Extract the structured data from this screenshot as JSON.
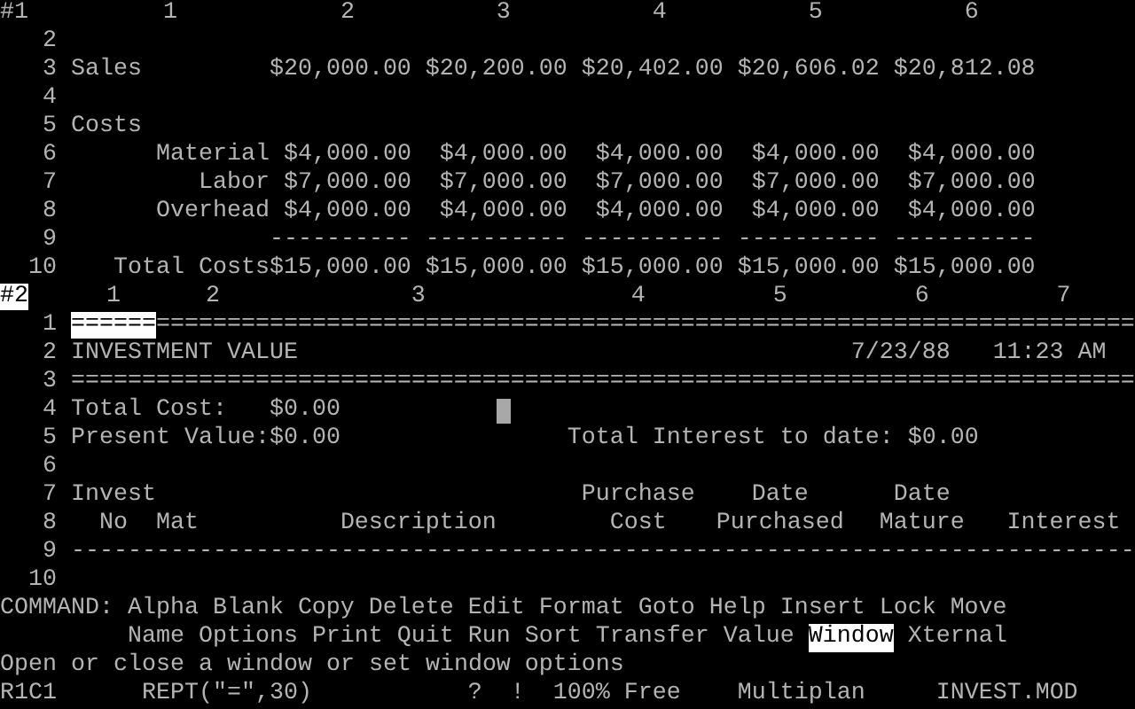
{
  "windows": [
    {
      "label": "#1",
      "active": false,
      "columns": [
        "1",
        "2",
        "3",
        "4",
        "5",
        "6"
      ],
      "rows": [
        {
          "number": "2",
          "text_cursor": false,
          "cells": []
        },
        {
          "number": "3",
          "text_cursor": false,
          "cells": [
            {
              "kind": "label",
              "text": "Sales",
              "selected": false
            },
            {
              "kind": "number",
              "text": "$20,000.00",
              "selected": false
            },
            {
              "kind": "number",
              "text": "$20,200.00",
              "selected": false
            },
            {
              "kind": "number",
              "text": "$20,402.00",
              "selected": false
            },
            {
              "kind": "number",
              "text": "$20,606.02",
              "selected": false
            },
            {
              "kind": "number",
              "text": "$20,812.08",
              "selected": false
            }
          ]
        },
        {
          "number": "4",
          "text_cursor": false,
          "cells": []
        },
        {
          "number": "5",
          "text_cursor": false,
          "cells": [
            {
              "kind": "label",
              "text": "Costs",
              "selected": false
            }
          ]
        },
        {
          "number": "6",
          "text_cursor": false,
          "cells": [
            {
              "kind": "item",
              "text": "Material",
              "selected": false
            },
            {
              "kind": "number",
              "text": "$4,000.00",
              "selected": false
            },
            {
              "kind": "number",
              "text": "$4,000.00",
              "selected": false
            },
            {
              "kind": "number",
              "text": "$4,000.00",
              "selected": false
            },
            {
              "kind": "number",
              "text": "$4,000.00",
              "selected": false
            },
            {
              "kind": "number",
              "text": "$4,000.00",
              "selected": false
            }
          ]
        },
        {
          "number": "7",
          "text_cursor": false,
          "cells": [
            {
              "kind": "item",
              "text": "Labor",
              "selected": false
            },
            {
              "kind": "number",
              "text": "$7,000.00",
              "selected": false
            },
            {
              "kind": "number",
              "text": "$7,000.00",
              "selected": false
            },
            {
              "kind": "number",
              "text": "$7,000.00",
              "selected": false
            },
            {
              "kind": "number",
              "text": "$7,000.00",
              "selected": false
            },
            {
              "kind": "number",
              "text": "$7,000.00",
              "selected": false
            }
          ]
        },
        {
          "number": "8",
          "text_cursor": false,
          "cells": [
            {
              "kind": "item",
              "text": "Overhead",
              "selected": false
            },
            {
              "kind": "number",
              "text": "$4,000.00",
              "selected": false
            },
            {
              "kind": "number",
              "text": "$4,000.00",
              "selected": false
            },
            {
              "kind": "number",
              "text": "$4,000.00",
              "selected": false
            },
            {
              "kind": "number",
              "text": "$4,000.00",
              "selected": false
            },
            {
              "kind": "number",
              "text": "$4,000.00",
              "selected": false
            }
          ]
        },
        {
          "number": "9",
          "text_cursor": false,
          "cells": [
            "",
            {
              "kind": "number",
              "text": "----------",
              "selected": false
            },
            {
              "kind": "number",
              "text": "----------",
              "selected": false
            },
            {
              "kind": "number",
              "text": "----------",
              "selected": false
            },
            {
              "kind": "number",
              "text": "----------",
              "selected": false
            },
            {
              "kind": "number",
              "text": "----------",
              "selected": false
            }
          ]
        },
        {
          "number": "10",
          "text_cursor": false,
          "cells": [
            {
              "kind": "item",
              "text": "Total Costs",
              "selected": false
            },
            {
              "kind": "number",
              "text": "$15,000.00",
              "selected": false
            },
            {
              "kind": "number",
              "text": "$15,000.00",
              "selected": false
            },
            {
              "kind": "number",
              "text": "$15,000.00",
              "selected": false
            },
            {
              "kind": "number",
              "text": "$15,000.00",
              "selected": false
            },
            {
              "kind": "number",
              "text": "$15,000.00",
              "selected": false
            }
          ]
        }
      ]
    },
    {
      "label": "#2",
      "active": true,
      "columns": [
        "1",
        "2",
        "3",
        "4",
        "5",
        "6",
        "7"
      ],
      "rows": [
        {
          "number": "1",
          "text_cursor": false,
          "cells": [
            {
              "kind": "label",
              "text": "======",
              "selected": true
            },
            {
              "kind": "label",
              "text": "=====================================================================",
              "selected": false
            }
          ]
        },
        {
          "number": "2",
          "text_cursor": false,
          "cells": [
            {
              "kind": "label",
              "text": "INVESTMENT VALUE",
              "selected": false
            },
            "",
            "",
            "",
            "",
            {
              "kind": "label",
              "text": "7/23/88",
              "selected": false
            },
            {
              "kind": "label",
              "text": "11:23 AM",
              "selected": false
            }
          ]
        },
        {
          "number": "3",
          "text_cursor": false,
          "cells": [
            {
              "kind": "label",
              "text": "===========================================================================",
              "selected": false
            }
          ]
        },
        {
          "number": "4",
          "text_cursor": true,
          "cells": [
            {
              "kind": "label",
              "text": "Total Cost:",
              "selected": false
            },
            "",
            {
              "kind": "label",
              "text": "$0.00",
              "selected": false
            }
          ]
        },
        {
          "number": "5",
          "text_cursor": false,
          "cells": [
            {
              "kind": "label",
              "text": "Present Value:",
              "selected": false
            },
            "",
            {
              "kind": "label",
              "text": "$0.00",
              "selected": false
            },
            {
              "kind": "label",
              "text": "Total Interest to date: $0.00",
              "selected": false
            }
          ]
        },
        {
          "number": "6",
          "text_cursor": false,
          "cells": []
        },
        {
          "number": "7",
          "text_cursor": false,
          "cells": [
            {
              "kind": "label",
              "text": "Invest",
              "selected": false
            },
            "",
            "",
            {
              "kind": "heading",
              "text": "Purchase",
              "selected": false
            },
            {
              "kind": "heading",
              "text": "Date",
              "selected": false
            },
            {
              "kind": "heading",
              "text": "Date",
              "selected": false
            }
          ]
        },
        {
          "number": "8",
          "text_cursor": false,
          "cells": [
            {
              "kind": "heading",
              "text": "No",
              "selected": false
            },
            {
              "kind": "label",
              "text": "Mat",
              "selected": false
            },
            {
              "kind": "heading",
              "text": "Description",
              "selected": false
            },
            {
              "kind": "heading",
              "text": "Cost",
              "selected": false
            },
            {
              "kind": "heading",
              "text": "Purchased",
              "selected": false
            },
            {
              "kind": "heading",
              "text": "Mature",
              "selected": false
            },
            {
              "kind": "heading",
              "text": "Interest",
              "selected": false
            }
          ]
        },
        {
          "number": "9",
          "text_cursor": false,
          "cells": [
            {
              "kind": "label",
              "text": "---------------------------------------------------------------------------",
              "selected": false
            }
          ]
        },
        {
          "number": "10",
          "text_cursor": false,
          "cells": []
        }
      ]
    }
  ],
  "command": {
    "label": "COMMAND:",
    "lines": [
      [
        {
          "label": "Alpha",
          "selected": false
        },
        {
          "label": "Blank",
          "selected": false
        },
        {
          "label": "Copy",
          "selected": false
        },
        {
          "label": "Delete",
          "selected": false
        },
        {
          "label": "Edit",
          "selected": false
        },
        {
          "label": "Format",
          "selected": false
        },
        {
          "label": "Goto",
          "selected": false
        },
        {
          "label": "Help",
          "selected": false
        },
        {
          "label": "Insert",
          "selected": false
        },
        {
          "label": "Lock",
          "selected": false
        },
        {
          "label": "Move",
          "selected": false
        }
      ],
      [
        {
          "label": "Name",
          "selected": false
        },
        {
          "label": "Options",
          "selected": false
        },
        {
          "label": "Print",
          "selected": false
        },
        {
          "label": "Quit",
          "selected": false
        },
        {
          "label": "Run",
          "selected": false
        },
        {
          "label": "Sort",
          "selected": false
        },
        {
          "label": "Transfer",
          "selected": false
        },
        {
          "label": "Value",
          "selected": false
        },
        {
          "label": "Window",
          "selected": true
        },
        {
          "label": "Xternal",
          "selected": false
        }
      ]
    ]
  },
  "message": "Open or close a window or set window options",
  "status": {
    "cell": "R1C1",
    "formula": "REPT(\"=\",30)",
    "query": "?",
    "alert": "!",
    "memory": "100% Free",
    "program": "Multiplan",
    "file": "INVEST.MOD"
  }
}
